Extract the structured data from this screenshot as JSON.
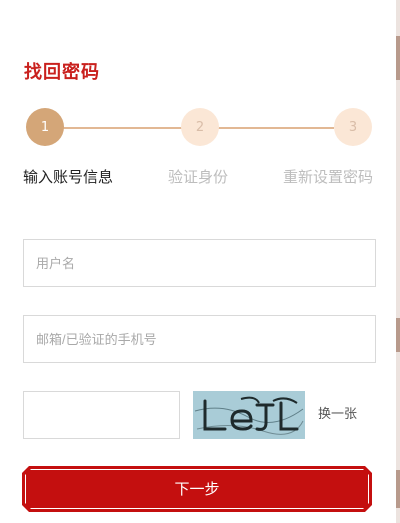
{
  "page": {
    "title": "找回密码"
  },
  "steps": [
    {
      "number": "1",
      "label": "输入账号信息",
      "state": "active"
    },
    {
      "number": "2",
      "label": "验证身份",
      "state": "todo"
    },
    {
      "number": "3",
      "label": "重新设置密码",
      "state": "todo"
    }
  ],
  "form": {
    "username": {
      "value": "",
      "placeholder": "用户名"
    },
    "contact": {
      "value": "",
      "placeholder": "邮箱/已验证的手机号"
    },
    "captcha_input": {
      "value": "",
      "placeholder": ""
    },
    "captcha_text": "LeJL",
    "captcha_swap_label": "换一张",
    "next_label": "下一步"
  },
  "colors": {
    "title": "#c9211e",
    "step_active": "#d4a678",
    "step_todo": "#fbe7d6",
    "step_line": "#e2b894",
    "button": "#c40f0f",
    "captcha_bg": "#a9ccd7"
  },
  "icons": {
    "captcha": "captcha-image"
  }
}
